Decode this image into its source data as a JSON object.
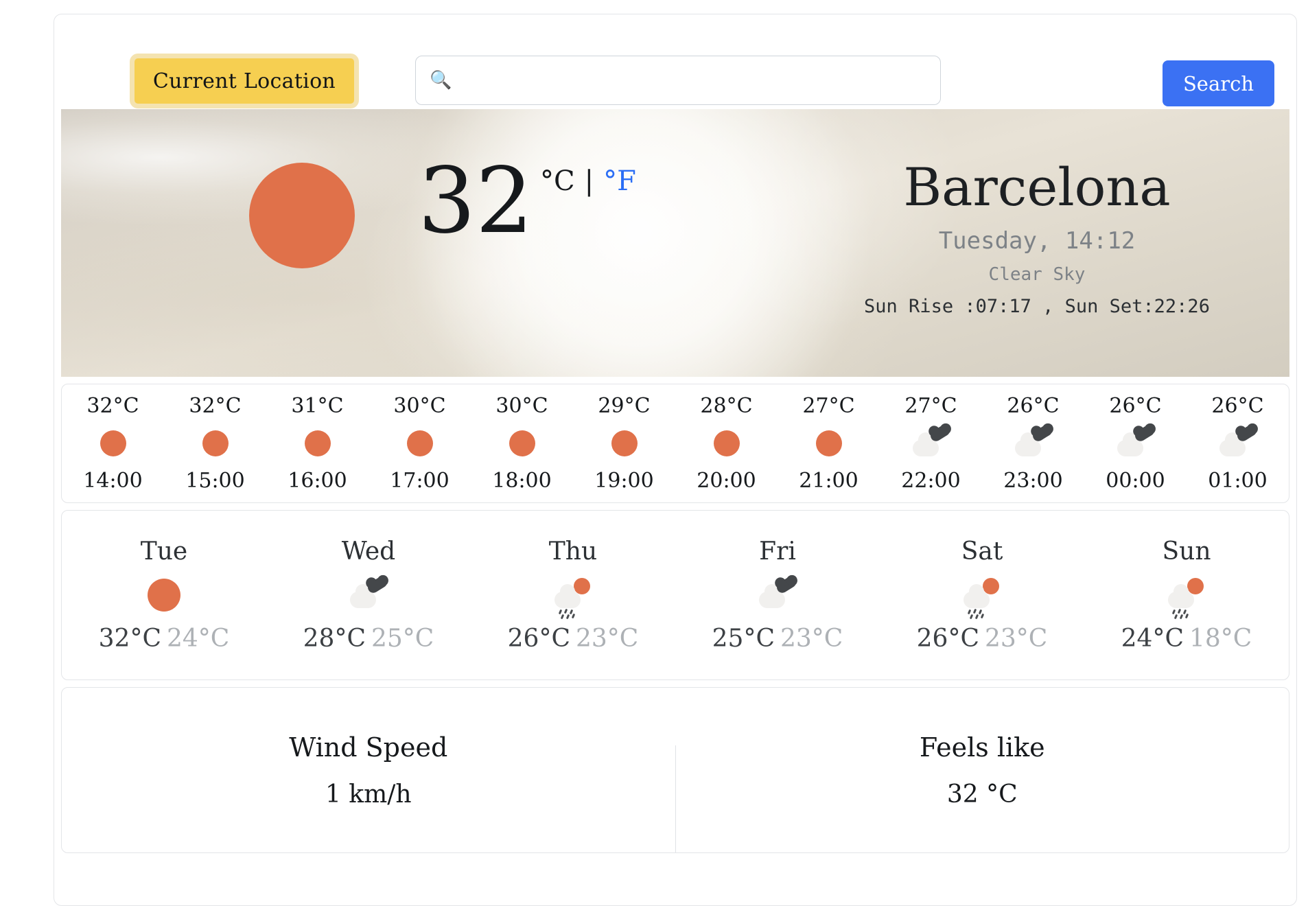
{
  "header": {
    "current_location_label": "Current Location",
    "search_placeholder": "🔍",
    "search_value": "",
    "search_button_label": "Search",
    "search_icon": "magnifying-glass-icon"
  },
  "hero": {
    "icon": "sun-icon",
    "temperature": "32",
    "unit_celsius": "°C",
    "unit_separator": "|",
    "unit_fahrenheit": "°F",
    "active_unit": "C",
    "city": "Barcelona",
    "datetime": "Tuesday, 14:12",
    "description": "Clear Sky",
    "sun_times": "Sun Rise :07:17 , Sun Set:22:26"
  },
  "hourly": [
    {
      "temp": "32°C",
      "icon": "sun-icon",
      "time": "14:00"
    },
    {
      "temp": "32°C",
      "icon": "sun-icon",
      "time": "15:00"
    },
    {
      "temp": "31°C",
      "icon": "sun-icon",
      "time": "16:00"
    },
    {
      "temp": "30°C",
      "icon": "sun-icon",
      "time": "17:00"
    },
    {
      "temp": "30°C",
      "icon": "sun-icon",
      "time": "18:00"
    },
    {
      "temp": "29°C",
      "icon": "sun-icon",
      "time": "19:00"
    },
    {
      "temp": "28°C",
      "icon": "sun-icon",
      "time": "20:00"
    },
    {
      "temp": "27°C",
      "icon": "sun-icon",
      "time": "21:00"
    },
    {
      "temp": "27°C",
      "icon": "broken-clouds-icon",
      "time": "22:00"
    },
    {
      "temp": "26°C",
      "icon": "broken-clouds-icon",
      "time": "23:00"
    },
    {
      "temp": "26°C",
      "icon": "broken-clouds-icon",
      "time": "00:00"
    },
    {
      "temp": "26°C",
      "icon": "broken-clouds-icon",
      "time": "01:00"
    }
  ],
  "daily": [
    {
      "day": "Tue",
      "icon": "sun-icon",
      "max": "32°C",
      "min": "24°C"
    },
    {
      "day": "Wed",
      "icon": "broken-clouds-icon",
      "max": "28°C",
      "min": "25°C"
    },
    {
      "day": "Thu",
      "icon": "sun-shower-icon",
      "max": "26°C",
      "min": "23°C"
    },
    {
      "day": "Fri",
      "icon": "broken-clouds-icon",
      "max": "25°C",
      "min": "23°C"
    },
    {
      "day": "Sat",
      "icon": "sun-shower-icon",
      "max": "26°C",
      "min": "23°C"
    },
    {
      "day": "Sun",
      "icon": "sun-shower-icon",
      "max": "24°C",
      "min": "18°C"
    }
  ],
  "stats": {
    "wind_label": "Wind Speed",
    "wind_value": "1 km/h",
    "feels_label": "Feels like",
    "feels_value": "32 °C"
  },
  "colors": {
    "accent_orange": "#e0714a",
    "button_yellow": "#f6cf51",
    "button_yellow_ring": "#f4e3b0",
    "search_blue": "#3b71f3",
    "unit_f_blue": "#2b6ef5",
    "text_dark": "#16191c",
    "text_muted": "#7d8287",
    "temp_min_gray": "#adb1b5",
    "border_gray": "#e3e5e8"
  }
}
